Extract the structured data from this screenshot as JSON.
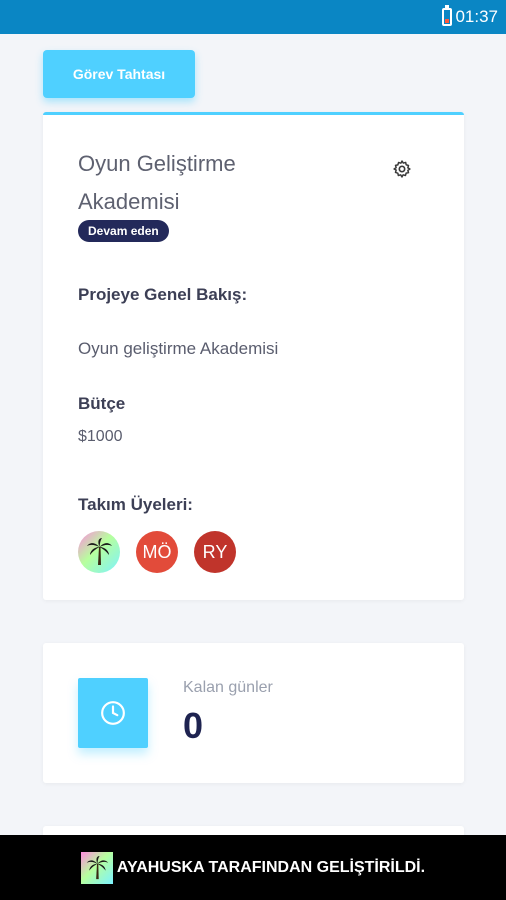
{
  "status_bar": {
    "time": "01:37",
    "battery_icon": "battery-low-icon"
  },
  "board_button": {
    "label": "Görev Tahtası"
  },
  "project": {
    "title": "Oyun Geliştirme Akademisi",
    "status": "Devam eden",
    "overview_label": "Projeye Genel Bakış:",
    "overview_text": "Oyun geliştirme Akademisi",
    "budget_label": "Bütçe",
    "budget_value": "$1000",
    "team_label": "Takım Üyeleri:",
    "members": [
      {
        "initials": "",
        "icon": "palm-tree-icon"
      },
      {
        "initials": "MÖ",
        "color": "#e24b3a"
      },
      {
        "initials": "RY",
        "color": "#c0342b"
      }
    ]
  },
  "days_left": {
    "label": "Kalan günler",
    "value": "0",
    "icon": "clock-icon"
  },
  "footer": {
    "text": "AYAHUSKA TARAFINDAN GELİŞTİRİLDİ.",
    "icon": "palm-tree-icon"
  },
  "colors": {
    "accent": "#4fd0ff",
    "status_bar": "#0a86c4",
    "badge": "#23295a"
  }
}
